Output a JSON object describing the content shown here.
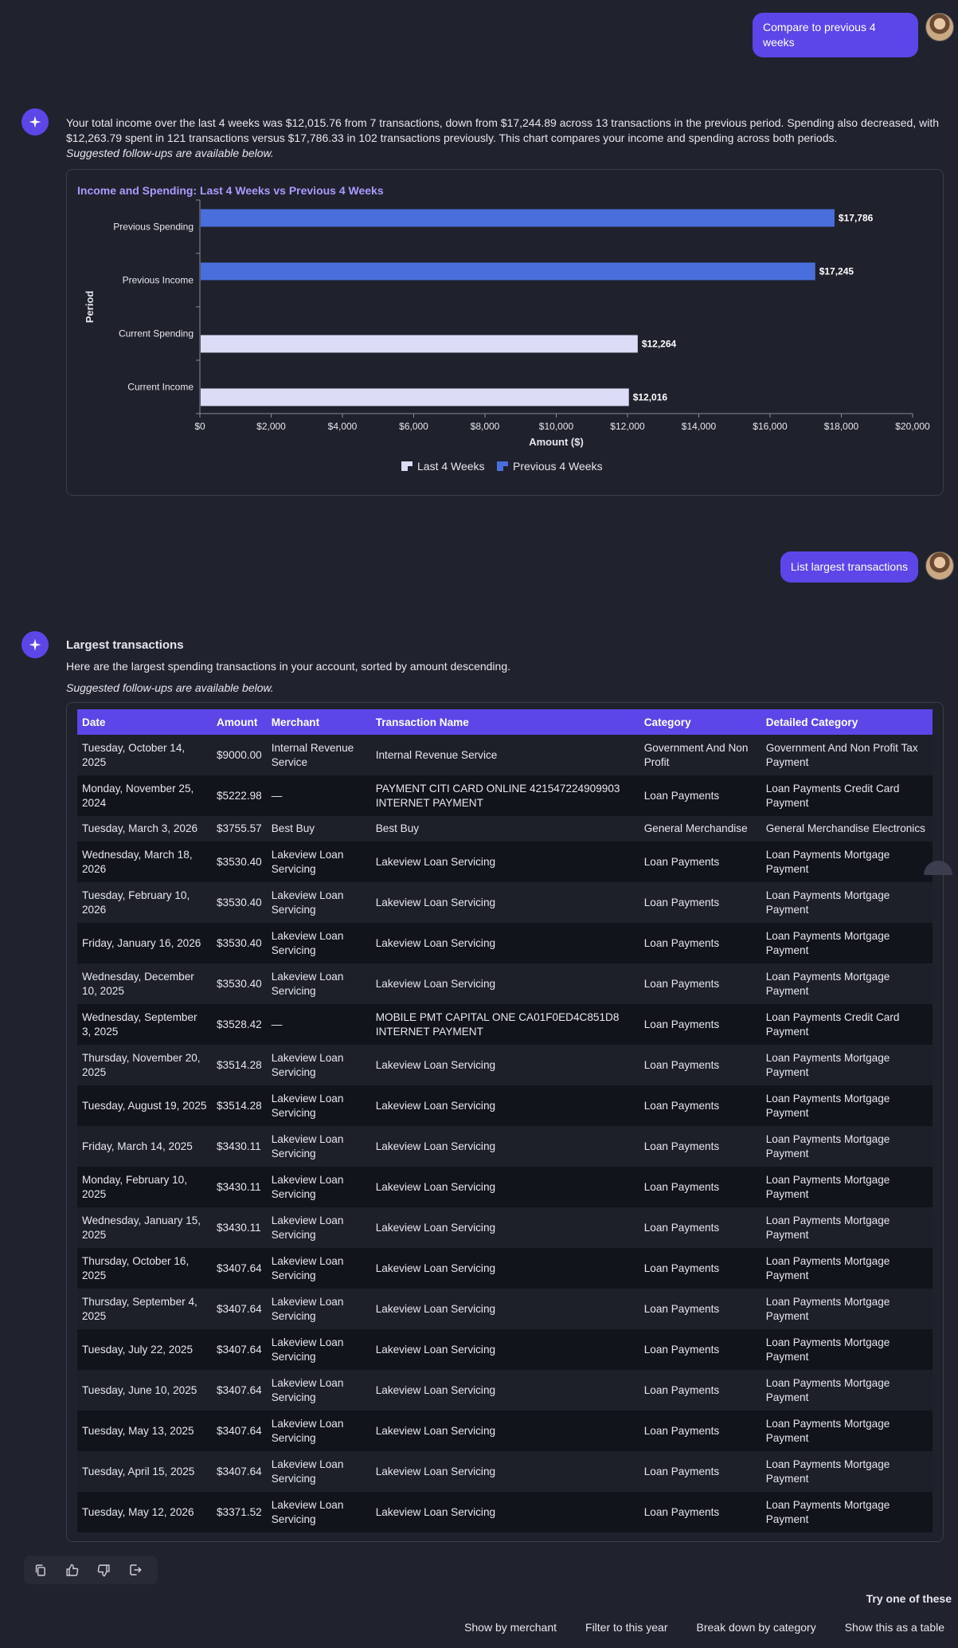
{
  "conversation": {
    "user_msg_1": "Compare to previous 4 weeks",
    "bot_msg_1": {
      "text": "Your total income over the last 4 weeks was $12,015.76 from 7 transactions, down from $17,244.89 across 13 transactions in the previous period. Spending also decreased, with $12,263.79 spent in 121 transactions versus $17,786.33 in 102 transactions previously. This chart compares your income and spending across both periods.",
      "followups_note": "Suggested follow-ups are available below."
    },
    "user_msg_2": "List largest transactions",
    "bot_msg_2": {
      "title": "Largest transactions",
      "text": "Here are the largest spending transactions in your account, sorted by amount descending.",
      "followups_note": "Suggested follow-ups are available below."
    }
  },
  "chart_data": {
    "type": "bar",
    "orientation": "horizontal",
    "title": "Income and Spending: Last 4 Weeks vs Previous 4 Weeks",
    "xlabel": "Amount ($)",
    "ylabel": "Period",
    "categories": [
      "Previous Spending",
      "Previous Income",
      "Current Spending",
      "Current Income"
    ],
    "series": [
      {
        "name": "Last 4 Weeks",
        "color": "#dcdcf7",
        "values": [
          null,
          null,
          12264,
          12016
        ]
      },
      {
        "name": "Previous 4 Weeks",
        "color": "#4a6fdc",
        "values": [
          17786,
          17245,
          null,
          null
        ]
      }
    ],
    "value_labels": [
      "$17,786",
      "$17,245",
      "$12,264",
      "$12,016"
    ],
    "xlim": [
      0,
      20000
    ],
    "xticks": [
      0,
      2000,
      4000,
      6000,
      8000,
      10000,
      12000,
      14000,
      16000,
      18000,
      20000
    ],
    "xtick_labels": [
      "$0",
      "$2,000",
      "$4,000",
      "$6,000",
      "$8,000",
      "$10,000",
      "$12,000",
      "$14,000",
      "$16,000",
      "$18,000",
      "$20,000"
    ],
    "grid": false,
    "legend_position": "bottom"
  },
  "table": {
    "headers": [
      "Date",
      "Amount",
      "Merchant",
      "Transaction Name",
      "Category",
      "Detailed Category"
    ],
    "rows": [
      [
        "Tuesday, October 14, 2025",
        "$9000.00",
        "Internal Revenue Service",
        "Internal Revenue Service",
        "Government And Non Profit",
        "Government And Non Profit Tax Payment"
      ],
      [
        "Monday, November 25, 2024",
        "$5222.98",
        "—",
        "PAYMENT CITI CARD ONLINE 421547224909903 INTERNET PAYMENT",
        "Loan Payments",
        "Loan Payments Credit Card Payment"
      ],
      [
        "Tuesday, March 3, 2026",
        "$3755.57",
        "Best Buy",
        "Best Buy",
        "General Merchandise",
        "General Merchandise Electronics"
      ],
      [
        "Wednesday, March 18, 2026",
        "$3530.40",
        "Lakeview Loan Servicing",
        "Lakeview Loan Servicing",
        "Loan Payments",
        "Loan Payments Mortgage Payment"
      ],
      [
        "Tuesday, February 10, 2026",
        "$3530.40",
        "Lakeview Loan Servicing",
        "Lakeview Loan Servicing",
        "Loan Payments",
        "Loan Payments Mortgage Payment"
      ],
      [
        "Friday, January 16, 2026",
        "$3530.40",
        "Lakeview Loan Servicing",
        "Lakeview Loan Servicing",
        "Loan Payments",
        "Loan Payments Mortgage Payment"
      ],
      [
        "Wednesday, December 10, 2025",
        "$3530.40",
        "Lakeview Loan Servicing",
        "Lakeview Loan Servicing",
        "Loan Payments",
        "Loan Payments Mortgage Payment"
      ],
      [
        "Wednesday, September 3, 2025",
        "$3528.42",
        "—",
        "MOBILE PMT CAPITAL ONE CA01F0ED4C851D8 INTERNET PAYMENT",
        "Loan Payments",
        "Loan Payments Credit Card Payment"
      ],
      [
        "Thursday, November 20, 2025",
        "$3514.28",
        "Lakeview Loan Servicing",
        "Lakeview Loan Servicing",
        "Loan Payments",
        "Loan Payments Mortgage Payment"
      ],
      [
        "Tuesday, August 19, 2025",
        "$3514.28",
        "Lakeview Loan Servicing",
        "Lakeview Loan Servicing",
        "Loan Payments",
        "Loan Payments Mortgage Payment"
      ],
      [
        "Friday, March 14, 2025",
        "$3430.11",
        "Lakeview Loan Servicing",
        "Lakeview Loan Servicing",
        "Loan Payments",
        "Loan Payments Mortgage Payment"
      ],
      [
        "Monday, February 10, 2025",
        "$3430.11",
        "Lakeview Loan Servicing",
        "Lakeview Loan Servicing",
        "Loan Payments",
        "Loan Payments Mortgage Payment"
      ],
      [
        "Wednesday, January 15, 2025",
        "$3430.11",
        "Lakeview Loan Servicing",
        "Lakeview Loan Servicing",
        "Loan Payments",
        "Loan Payments Mortgage Payment"
      ],
      [
        "Thursday, October 16, 2025",
        "$3407.64",
        "Lakeview Loan Servicing",
        "Lakeview Loan Servicing",
        "Loan Payments",
        "Loan Payments Mortgage Payment"
      ],
      [
        "Thursday, September 4, 2025",
        "$3407.64",
        "Lakeview Loan Servicing",
        "Lakeview Loan Servicing",
        "Loan Payments",
        "Loan Payments Mortgage Payment"
      ],
      [
        "Tuesday, July 22, 2025",
        "$3407.64",
        "Lakeview Loan Servicing",
        "Lakeview Loan Servicing",
        "Loan Payments",
        "Loan Payments Mortgage Payment"
      ],
      [
        "Tuesday, June 10, 2025",
        "$3407.64",
        "Lakeview Loan Servicing",
        "Lakeview Loan Servicing",
        "Loan Payments",
        "Loan Payments Mortgage Payment"
      ],
      [
        "Tuesday, May 13, 2025",
        "$3407.64",
        "Lakeview Loan Servicing",
        "Lakeview Loan Servicing",
        "Loan Payments",
        "Loan Payments Mortgage Payment"
      ],
      [
        "Tuesday, April 15, 2025",
        "$3407.64",
        "Lakeview Loan Servicing",
        "Lakeview Loan Servicing",
        "Loan Payments",
        "Loan Payments Mortgage Payment"
      ],
      [
        "Tuesday, May 12, 2026",
        "$3371.52",
        "Lakeview Loan Servicing",
        "Lakeview Loan Servicing",
        "Loan Payments",
        "Loan Payments Mortgage Payment"
      ]
    ]
  },
  "suggestions": {
    "heading": "Try one of these",
    "chips": [
      "Show by merchant",
      "Filter to this year",
      "Break down by category",
      "Show this as a table"
    ]
  },
  "icons": {
    "assistant": "sparkle-icon",
    "copy": "copy-icon",
    "like": "thumbs-up-icon",
    "dislike": "thumbs-down-icon",
    "share": "share-icon"
  },
  "colors": {
    "accent": "#5b47e8",
    "background": "#20222e",
    "chart_title": "#a99bff"
  }
}
